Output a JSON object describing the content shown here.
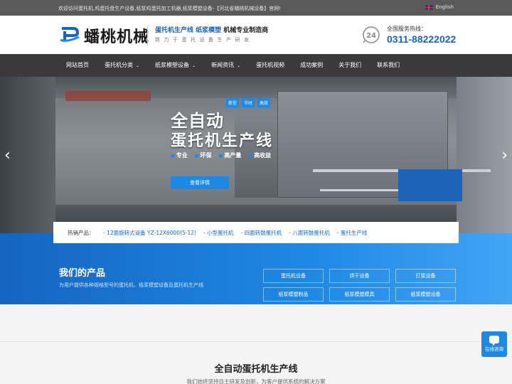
{
  "topbar": {
    "welcome": "欢迎访问蛋托机,鸡蛋托盘生产设备,纸浆鸡蛋托加工机器,纸浆模塑设备-【河北省蟠桃机械设备】官网!",
    "language": "English"
  },
  "header": {
    "logo_text": "蟠桃机械",
    "slogan_blue": "蛋托机生产线 纸浆模塑",
    "slogan_dark": "机械专业制造商",
    "slogan_sub": "致力于蛋托设备生产研发",
    "hotline_label": "全国服务热线：",
    "hotline_number": "0311-88222022",
    "hotline_icon_text": "24"
  },
  "nav": {
    "items": [
      {
        "label": "网站首页",
        "dropdown": false
      },
      {
        "label": "蛋托机分类",
        "dropdown": true
      },
      {
        "label": "纸浆模塑设备",
        "dropdown": true
      },
      {
        "label": "新闻资讯",
        "dropdown": true
      },
      {
        "label": "蛋托机视频",
        "dropdown": false
      },
      {
        "label": "成功案例",
        "dropdown": false
      },
      {
        "label": "关于我们",
        "dropdown": false
      },
      {
        "label": "联系我们",
        "dropdown": false
      }
    ],
    "caret": "⌄"
  },
  "banner": {
    "tags": [
      "新型",
      "节时",
      "高效"
    ],
    "title1": "全自动",
    "title2": "蛋托机生产线",
    "features": [
      "专业",
      "环保",
      "高产量",
      "高收益"
    ],
    "button": "查看详情",
    "prev_arrow": "‹",
    "next_arrow": "›"
  },
  "hot": {
    "label": "热销产品：",
    "links": [
      "12面旋转式设备 YZ-12X6000(5-12)",
      "小型蛋托机",
      "四面转鼓蛋托机",
      "八面转鼓蛋托机",
      "蛋托生产线"
    ]
  },
  "products": {
    "title": "我们的产品",
    "subtitle": "为用户提供各种规格型号的蛋托机、纸浆模塑设备及蛋托机生产线",
    "categories": [
      "蛋托机设备",
      "烘干设备",
      "打浆设备",
      "纸浆模塑制品",
      "纸浆模塑模具",
      "纸浆模塑设备"
    ]
  },
  "lower": {
    "title": "全自动蛋托机生产线",
    "subtitle": "我们始终坚持自主研发及创新，为客户提供系统的解决方案"
  },
  "online": {
    "label": "在线咨询"
  },
  "colors": {
    "brand_blue": "#1565c0",
    "accent_blue": "#1e88e5",
    "nav_bg": "#3a3a3a"
  }
}
